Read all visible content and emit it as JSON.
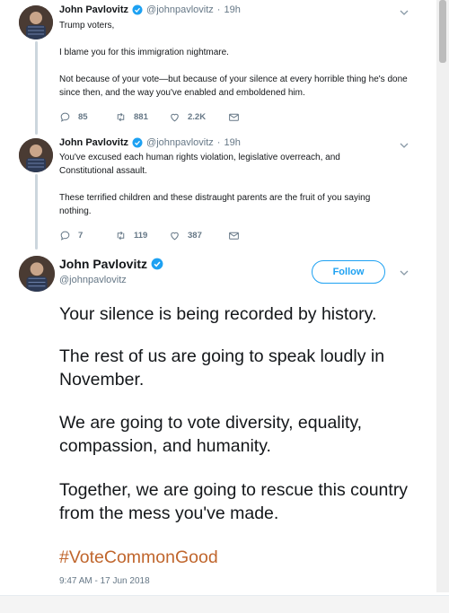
{
  "tweets": [
    {
      "name": "John Pavlovitz",
      "handle": "@johnpavlovitz",
      "time": "19h",
      "text": "Trump voters,\n\nI blame you for this immigration nightmare.\n\nNot because of your vote—but because of your silence at every horrible thing he's done since then, and the way you've enabled and emboldened him.",
      "replies": "85",
      "retweets": "881",
      "likes": "2.2K"
    },
    {
      "name": "John Pavlovitz",
      "handle": "@johnpavlovitz",
      "time": "19h",
      "text": "You've excused each human rights violation, legislative overreach, and Constitutional assault.\n\nThese terrified children and these distraught parents are the fruit of you saying nothing.",
      "replies": "7",
      "retweets": "119",
      "likes": "387"
    }
  ],
  "main_tweet": {
    "name": "John Pavlovitz",
    "handle": "@johnpavlovitz",
    "follow_label": "Follow",
    "paragraphs": [
      "Your silence is being recorded by history.",
      "The rest of us are going to speak loudly in November.",
      "We are going to vote diversity, equality, compassion, and humanity.",
      "Together, we are going to rescue this country from the mess you've made."
    ],
    "hashtag": "#VoteCommonGood",
    "timestamp": "9:47 AM - 17 Jun 2018"
  },
  "icons": {
    "reply": "reply-icon",
    "retweet": "retweet-icon",
    "like": "heart-icon",
    "dm": "envelope-icon",
    "verified": "verified-badge-icon",
    "caret": "chevron-down-icon"
  },
  "colors": {
    "verified_blue": "#1da1f2",
    "hashtag": "#c0662d",
    "secondary_text": "#657786",
    "thread_line": "#ccd6dd"
  }
}
